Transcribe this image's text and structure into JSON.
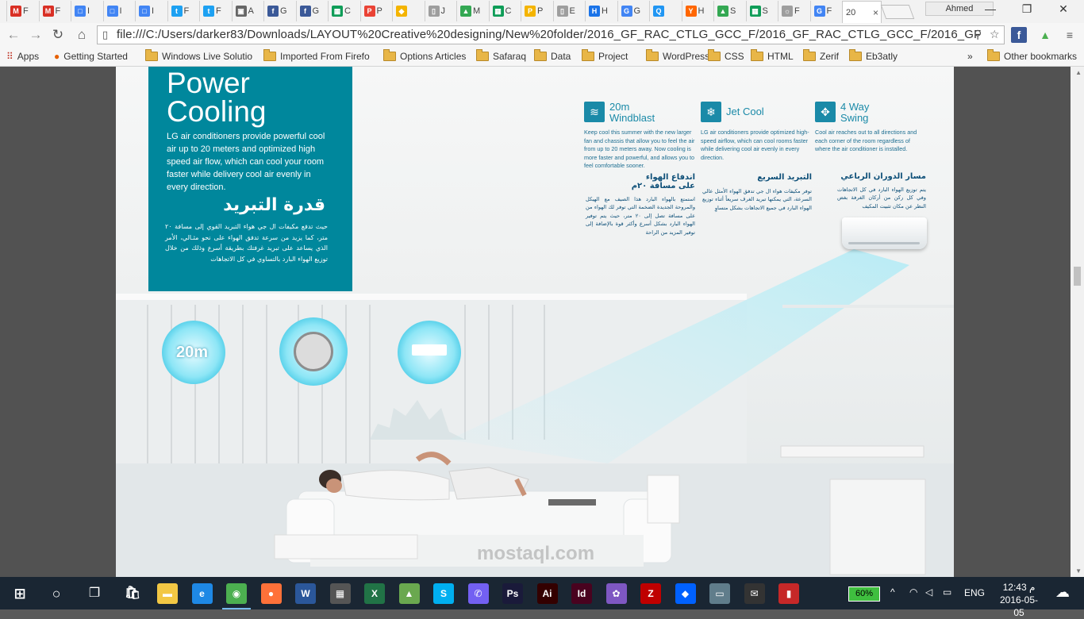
{
  "browser": {
    "tabs": [
      {
        "label": "F",
        "favicon": "M",
        "color": "#d93025"
      },
      {
        "label": "F",
        "favicon": "M",
        "color": "#d93025"
      },
      {
        "label": "I",
        "favicon": "□",
        "color": "#4285f4"
      },
      {
        "label": "I",
        "favicon": "□",
        "color": "#4285f4"
      },
      {
        "label": "I",
        "favicon": "□",
        "color": "#4285f4"
      },
      {
        "label": "F",
        "favicon": "t",
        "color": "#1da1f2"
      },
      {
        "label": "F",
        "favicon": "t",
        "color": "#1da1f2"
      },
      {
        "label": "A",
        "favicon": "▣",
        "color": "#666666"
      },
      {
        "label": "G",
        "favicon": "f",
        "color": "#3b5998"
      },
      {
        "label": "G",
        "favicon": "f",
        "color": "#3b5998"
      },
      {
        "label": "C",
        "favicon": "▦",
        "color": "#0f9d58"
      },
      {
        "label": "P",
        "favicon": "P",
        "color": "#ea4335"
      },
      {
        "label": "",
        "favicon": "◆",
        "color": "#f4b400"
      },
      {
        "label": "J",
        "favicon": "▯",
        "color": "#9e9e9e"
      },
      {
        "label": "M",
        "favicon": "▲",
        "color": "#34a853"
      },
      {
        "label": "C",
        "favicon": "▦",
        "color": "#0f9d58"
      },
      {
        "label": "P",
        "favicon": "P",
        "color": "#f4b400"
      },
      {
        "label": "E",
        "favicon": "▯",
        "color": "#9e9e9e"
      },
      {
        "label": "H",
        "favicon": "H",
        "color": "#1a73e8"
      },
      {
        "label": "G",
        "favicon": "G",
        "color": "#4285f4"
      },
      {
        "label": "",
        "favicon": "Q",
        "color": "#2196f3"
      },
      {
        "label": "H",
        "favicon": "Y",
        "color": "#ff6600"
      },
      {
        "label": "S",
        "favicon": "▲",
        "color": "#34a853"
      },
      {
        "label": "S",
        "favicon": "▦",
        "color": "#0f9d58"
      },
      {
        "label": "F",
        "favicon": "☼",
        "color": "#9e9e9e"
      },
      {
        "label": "F",
        "favicon": "G",
        "color": "#4285f4"
      },
      {
        "label": "20",
        "favicon": "",
        "color": "#ffffff",
        "active": true
      }
    ],
    "active_tab_close": "×",
    "profile_name": "Ahmed",
    "window_controls": {
      "minimize": "—",
      "maximize": "❐",
      "close": "✕"
    },
    "url": "file:///C:/Users/darker83/Downloads/LAYOUT%20Creative%20designing/New%20folder/2016_GF_RAC_CTLG_GCC_F/2016_GF_RAC_CTLG_GCC_F/2016_GF",
    "bookmarks": [
      {
        "label": "Apps",
        "icon": "apps-grid"
      },
      {
        "label": "Getting Started",
        "icon": "firefox"
      },
      {
        "label": "Windows Live Solutio",
        "icon": "folder"
      },
      {
        "label": "Imported From Firefo",
        "icon": "folder"
      },
      {
        "label": "Options Articles",
        "icon": "folder"
      },
      {
        "label": "Safaraq",
        "icon": "folder"
      },
      {
        "label": "Data",
        "icon": "folder"
      },
      {
        "label": "Project",
        "icon": "folder"
      },
      {
        "label": "WordPress",
        "icon": "folder"
      },
      {
        "label": "CSS",
        "icon": "folder"
      },
      {
        "label": "HTML",
        "icon": "folder"
      },
      {
        "label": "Zerif",
        "icon": "folder"
      },
      {
        "label": "Eb3atly",
        "icon": "folder"
      }
    ],
    "bookmarks_overflow": "»",
    "other_bookmarks": "Other bookmarks"
  },
  "document": {
    "panel": {
      "title": "Power\nCooling",
      "body": "LG air conditioners provide powerful cool air up to 20 meters and optimized high speed air flow, which can cool your room faster while delivery cool air evenly in every direction.",
      "ar_title": "قدرة التبريد",
      "ar_body": "حيث تدفع مكيفات ال جي هواء التبريد القوي إلى مسافة ٢٠ متر، كما يزيد من سرعة تدفق الهواء على نحو مثـالي، الأمر الذي يساعد على تبريد غرفتك بطريقة أسرع وذلك من خلال توزيع الهواء البارد بالتساوي في كل الاتجاهات"
    },
    "features": [
      {
        "title": "20m\nWindblast",
        "icon": "windblast-icon",
        "body": "Keep cool this summer with the new larger fan and chassis that allow you to feel the air from up to 20 meters away. Now cooling is more faster and powerful, and allows you to feel comfortable sooner.",
        "ar_title": "اندفاع الهواء\nعلى مسافة ٢٠م",
        "ar_body": "استمتع بالهواء البارد هذا الصيف مع الهيكل والمروحة الجديدة الضخمة التي توفر لك الهواء من على مسافة تصل إلى ٢٠ متر، حيث يتم توفير الهواء البارد بشكل أسرع وأكثر قوة بالإضافة إلى توفير المزيد من الراحة"
      },
      {
        "title": "Jet Cool",
        "icon": "jet-cool-icon",
        "body": "LG air conditioners provide optimized high-speed airflow, which can cool rooms faster while delivering cool air evenly in every direction.",
        "ar_title": "التبريد السريع",
        "ar_body": "توفر مكيفات هواء ال جي تدفق الهواء الأمثل عالي السرعة، التي يمكنها تبريد الغرف سريعاً أثناء توزيع الهواء البارد في جميع الاتجاهات بشكل متساوٍ"
      },
      {
        "title": "4 Way\nSwing",
        "icon": "four-way-swing-icon",
        "body": "Cool air reaches out to all directions and each corner of the room regardless of where the air conditioner is installed.",
        "ar_title": "مسار الدوران الرباعي",
        "ar_body": "يتم توزيع الهواء البارد في كل الاتجاهات وفي كل ركن من أركان الغرفة بغض النظر عن مكان تثبيت المكيف"
      }
    ],
    "circle_label": "20m",
    "watermark": "mostaql.com"
  },
  "taskbar": {
    "apps": [
      {
        "name": "file-explorer",
        "glyph": "▬",
        "color": "#f2c744"
      },
      {
        "name": "edge",
        "glyph": "e",
        "color": "#1e88e5"
      },
      {
        "name": "chrome",
        "glyph": "◉",
        "color": "#4caf50",
        "active": true
      },
      {
        "name": "firefox",
        "glyph": "●",
        "color": "#ff7139"
      },
      {
        "name": "word",
        "glyph": "W",
        "color": "#2b579a"
      },
      {
        "name": "calculator",
        "glyph": "▦",
        "color": "#555555"
      },
      {
        "name": "excel",
        "glyph": "X",
        "color": "#217346"
      },
      {
        "name": "image-viewer",
        "glyph": "▲",
        "color": "#6aa84f"
      },
      {
        "name": "skype",
        "glyph": "S",
        "color": "#00aff0"
      },
      {
        "name": "viber",
        "glyph": "✆",
        "color": "#7360f2"
      },
      {
        "name": "photoshop",
        "glyph": "Ps",
        "color": "#1a1a3a"
      },
      {
        "name": "illustrator",
        "glyph": "Ai",
        "color": "#330000"
      },
      {
        "name": "indesign",
        "glyph": "Id",
        "color": "#49021f"
      },
      {
        "name": "paint",
        "glyph": "✿",
        "color": "#7e57c2"
      },
      {
        "name": "filezilla",
        "glyph": "Z",
        "color": "#bf0000"
      },
      {
        "name": "dropbox",
        "glyph": "◆",
        "color": "#0061ff"
      },
      {
        "name": "remote",
        "glyph": "▭",
        "color": "#607d8b"
      },
      {
        "name": "mail",
        "glyph": "✉",
        "color": "#333333"
      },
      {
        "name": "flag-app",
        "glyph": "▮",
        "color": "#c62828"
      }
    ],
    "battery": "60%",
    "language": "ENG",
    "time": "12:43 م",
    "date": "2016-05-05",
    "start_label": "⊞"
  }
}
